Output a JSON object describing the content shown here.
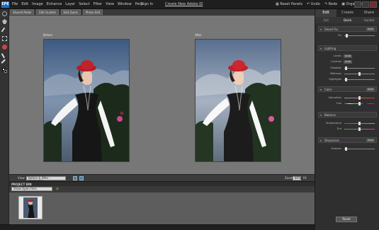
{
  "app": {
    "logo": "EPE"
  },
  "menu": [
    "File",
    "Edit",
    "Image",
    "Enhance",
    "Layer",
    "Select",
    "Filter",
    "View",
    "Window",
    "Help"
  ],
  "account": {
    "signin": "Sign In",
    "create": "Create New Adobe ID"
  },
  "toolbar_right": {
    "reset_panels": "Reset Panels",
    "undo": "Undo",
    "redo": "Redo",
    "organizer": "Organizer"
  },
  "doc_tabs": [
    "Shared Pedal",
    "Edit Guided",
    "Edit Quick",
    "Photo Edit"
  ],
  "canvas": {
    "before_label": "Before",
    "after_label": "After"
  },
  "status": {
    "view_label": "View:",
    "view_value": "Before & After - Horizontal",
    "zoom_label": "Zoom:",
    "zoom_value": "80%",
    "fit_label": "Fit"
  },
  "project_bin": {
    "title": "PROJECT BIN",
    "source": "Show Open Files"
  },
  "panel": {
    "tabs": [
      "Edit",
      "Create",
      "Share"
    ],
    "modes": [
      "Full",
      "Quick",
      "Guided"
    ],
    "sections": [
      {
        "title": "Smart Fix",
        "auto": "Auto",
        "rows": [
          {
            "label": "Fix"
          }
        ]
      },
      {
        "title": "Lighting",
        "rows": [
          {
            "label": "Levels",
            "auto": "Auto"
          },
          {
            "label": "Contrast",
            "auto": "Auto"
          },
          {
            "label": "Shadows"
          },
          {
            "label": "Midtones"
          },
          {
            "label": "Highlights"
          }
        ]
      },
      {
        "title": "Color",
        "auto": "Auto",
        "rows": [
          {
            "label": "Saturation"
          },
          {
            "label": "Hue"
          }
        ]
      },
      {
        "title": "Balance",
        "rows": [
          {
            "label": "Temperature"
          },
          {
            "label": "Tint"
          }
        ]
      },
      {
        "title": "Sharpness",
        "auto": "Auto",
        "rows": [
          {
            "label": "Sharpen"
          }
        ]
      }
    ],
    "reset": "Reset"
  },
  "colors": {
    "accent": "#1f6bc2",
    "panel_bg": "#2f2f2f",
    "canvas_bg": "#777777"
  }
}
